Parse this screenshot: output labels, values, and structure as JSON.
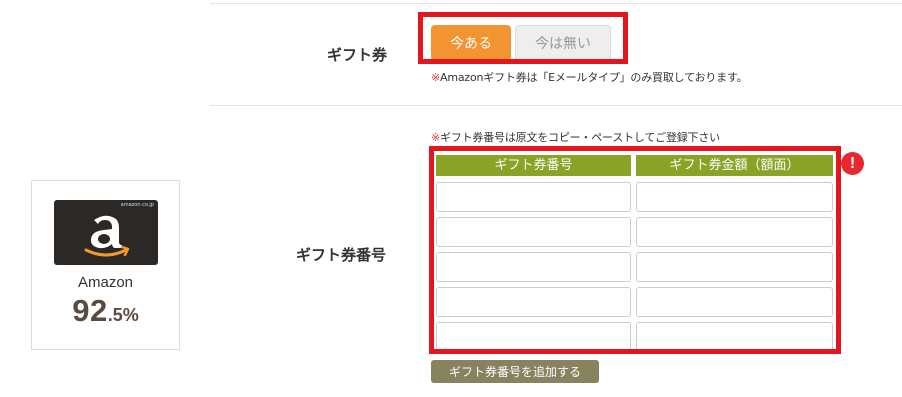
{
  "card": {
    "image_label": "amazon.co.jp",
    "brand": "Amazon",
    "rate_number": "92",
    "rate_suffix": ".5%"
  },
  "gift_card_row": {
    "label": "ギフト券",
    "options": [
      "今ある",
      "今は無い"
    ],
    "selected": "今ある",
    "note_mark": "※",
    "note_text": "Amazonギフト券は「Eメールタイプ」のみ買取しております。"
  },
  "gift_number_row": {
    "label": "ギフト券番号",
    "note_mark": "※",
    "note_text": "ギフト券番号は原文をコピー・ペーストしてご登録下さい",
    "columns": [
      "ギフト券番号",
      "ギフト券金額（額面）"
    ],
    "rows": [
      [
        "",
        ""
      ],
      [
        "",
        ""
      ],
      [
        "",
        ""
      ],
      [
        "",
        ""
      ],
      [
        "",
        ""
      ]
    ],
    "alert_symbol": "!",
    "add_button": "ギフト券番号を追加する"
  },
  "colors": {
    "selected_button": "#f39433",
    "header_green": "#8aa326",
    "highlight_red": "#e2161e",
    "add_button": "#87835f",
    "rate_brown": "#5c4a3f"
  }
}
